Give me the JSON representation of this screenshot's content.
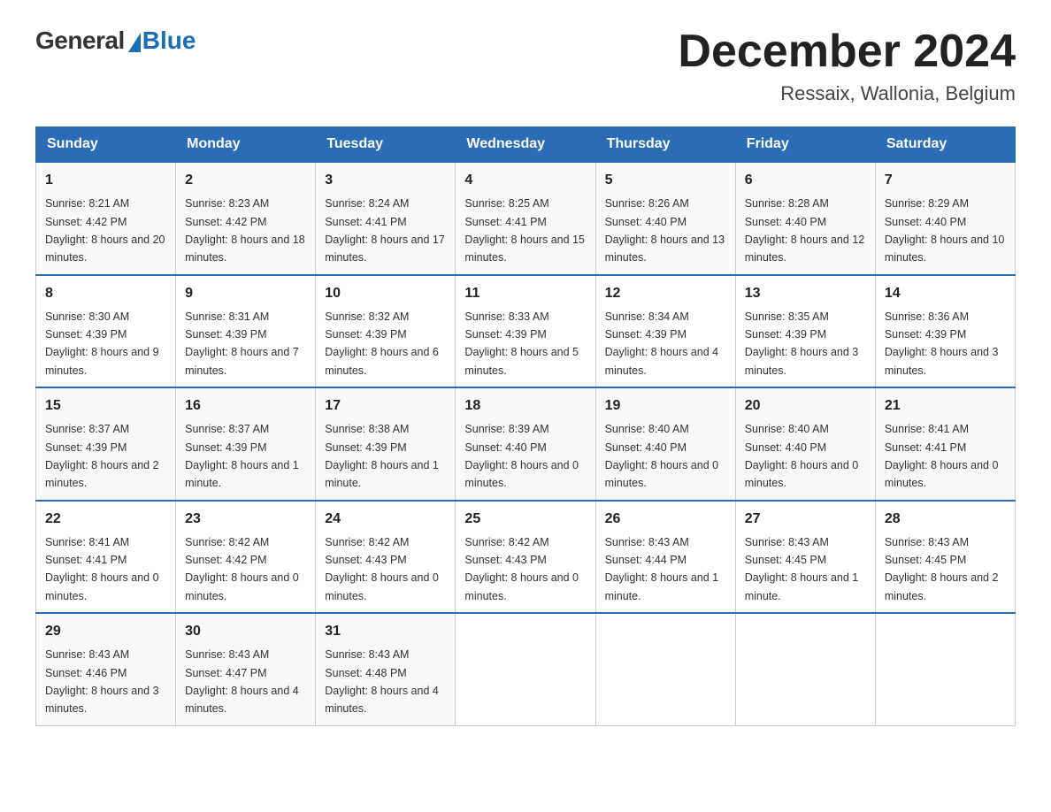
{
  "header": {
    "logo_general": "General",
    "logo_blue": "Blue",
    "month_title": "December 2024",
    "location": "Ressaix, Wallonia, Belgium"
  },
  "weekdays": [
    "Sunday",
    "Monday",
    "Tuesday",
    "Wednesday",
    "Thursday",
    "Friday",
    "Saturday"
  ],
  "weeks": [
    [
      {
        "day": "1",
        "sunrise": "8:21 AM",
        "sunset": "4:42 PM",
        "daylight": "8 hours and 20 minutes."
      },
      {
        "day": "2",
        "sunrise": "8:23 AM",
        "sunset": "4:42 PM",
        "daylight": "8 hours and 18 minutes."
      },
      {
        "day": "3",
        "sunrise": "8:24 AM",
        "sunset": "4:41 PM",
        "daylight": "8 hours and 17 minutes."
      },
      {
        "day": "4",
        "sunrise": "8:25 AM",
        "sunset": "4:41 PM",
        "daylight": "8 hours and 15 minutes."
      },
      {
        "day": "5",
        "sunrise": "8:26 AM",
        "sunset": "4:40 PM",
        "daylight": "8 hours and 13 minutes."
      },
      {
        "day": "6",
        "sunrise": "8:28 AM",
        "sunset": "4:40 PM",
        "daylight": "8 hours and 12 minutes."
      },
      {
        "day": "7",
        "sunrise": "8:29 AM",
        "sunset": "4:40 PM",
        "daylight": "8 hours and 10 minutes."
      }
    ],
    [
      {
        "day": "8",
        "sunrise": "8:30 AM",
        "sunset": "4:39 PM",
        "daylight": "8 hours and 9 minutes."
      },
      {
        "day": "9",
        "sunrise": "8:31 AM",
        "sunset": "4:39 PM",
        "daylight": "8 hours and 7 minutes."
      },
      {
        "day": "10",
        "sunrise": "8:32 AM",
        "sunset": "4:39 PM",
        "daylight": "8 hours and 6 minutes."
      },
      {
        "day": "11",
        "sunrise": "8:33 AM",
        "sunset": "4:39 PM",
        "daylight": "8 hours and 5 minutes."
      },
      {
        "day": "12",
        "sunrise": "8:34 AM",
        "sunset": "4:39 PM",
        "daylight": "8 hours and 4 minutes."
      },
      {
        "day": "13",
        "sunrise": "8:35 AM",
        "sunset": "4:39 PM",
        "daylight": "8 hours and 3 minutes."
      },
      {
        "day": "14",
        "sunrise": "8:36 AM",
        "sunset": "4:39 PM",
        "daylight": "8 hours and 3 minutes."
      }
    ],
    [
      {
        "day": "15",
        "sunrise": "8:37 AM",
        "sunset": "4:39 PM",
        "daylight": "8 hours and 2 minutes."
      },
      {
        "day": "16",
        "sunrise": "8:37 AM",
        "sunset": "4:39 PM",
        "daylight": "8 hours and 1 minute."
      },
      {
        "day": "17",
        "sunrise": "8:38 AM",
        "sunset": "4:39 PM",
        "daylight": "8 hours and 1 minute."
      },
      {
        "day": "18",
        "sunrise": "8:39 AM",
        "sunset": "4:40 PM",
        "daylight": "8 hours and 0 minutes."
      },
      {
        "day": "19",
        "sunrise": "8:40 AM",
        "sunset": "4:40 PM",
        "daylight": "8 hours and 0 minutes."
      },
      {
        "day": "20",
        "sunrise": "8:40 AM",
        "sunset": "4:40 PM",
        "daylight": "8 hours and 0 minutes."
      },
      {
        "day": "21",
        "sunrise": "8:41 AM",
        "sunset": "4:41 PM",
        "daylight": "8 hours and 0 minutes."
      }
    ],
    [
      {
        "day": "22",
        "sunrise": "8:41 AM",
        "sunset": "4:41 PM",
        "daylight": "8 hours and 0 minutes."
      },
      {
        "day": "23",
        "sunrise": "8:42 AM",
        "sunset": "4:42 PM",
        "daylight": "8 hours and 0 minutes."
      },
      {
        "day": "24",
        "sunrise": "8:42 AM",
        "sunset": "4:43 PM",
        "daylight": "8 hours and 0 minutes."
      },
      {
        "day": "25",
        "sunrise": "8:42 AM",
        "sunset": "4:43 PM",
        "daylight": "8 hours and 0 minutes."
      },
      {
        "day": "26",
        "sunrise": "8:43 AM",
        "sunset": "4:44 PM",
        "daylight": "8 hours and 1 minute."
      },
      {
        "day": "27",
        "sunrise": "8:43 AM",
        "sunset": "4:45 PM",
        "daylight": "8 hours and 1 minute."
      },
      {
        "day": "28",
        "sunrise": "8:43 AM",
        "sunset": "4:45 PM",
        "daylight": "8 hours and 2 minutes."
      }
    ],
    [
      {
        "day": "29",
        "sunrise": "8:43 AM",
        "sunset": "4:46 PM",
        "daylight": "8 hours and 3 minutes."
      },
      {
        "day": "30",
        "sunrise": "8:43 AM",
        "sunset": "4:47 PM",
        "daylight": "8 hours and 4 minutes."
      },
      {
        "day": "31",
        "sunrise": "8:43 AM",
        "sunset": "4:48 PM",
        "daylight": "8 hours and 4 minutes."
      },
      null,
      null,
      null,
      null
    ]
  ],
  "labels": {
    "sunrise": "Sunrise:",
    "sunset": "Sunset:",
    "daylight": "Daylight:"
  }
}
